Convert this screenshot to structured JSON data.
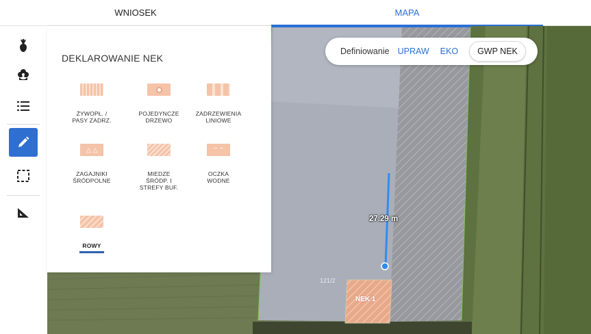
{
  "tabs": {
    "wniosek": "WNIOSEK",
    "mapa": "MAPA"
  },
  "rail": {
    "items": [
      {
        "icon": "crop-icon"
      },
      {
        "icon": "eco-flower-icon"
      },
      {
        "icon": "list-icon"
      },
      {
        "icon": "pencil-icon",
        "active": true
      },
      {
        "icon": "selection-icon"
      },
      {
        "icon": "ruler-icon"
      }
    ]
  },
  "panel": {
    "title": "DEKLAROWANIE NEK",
    "tiles": [
      {
        "label": "ŻYWOPŁ. /\nPASY ZADRZ."
      },
      {
        "label": "POJEDYNCZE\nDRZEWO"
      },
      {
        "label": "ZADRZEWIENIA\nLINIOWE"
      },
      {
        "label": "ZAGAJNIKI\nŚRÓDPOLNE"
      },
      {
        "label": "MIEDZE\nŚRÓDP. I\nSTREFY BUF."
      },
      {
        "label": "OCZKA\nWODNE"
      },
      {
        "label": "ROWY",
        "selected": true
      }
    ]
  },
  "definiowanie": {
    "lead": "Definiowanie",
    "options": [
      "UPRAW",
      "EKO"
    ],
    "selected": "GWP NEK"
  },
  "map": {
    "measurement": "27.29 m",
    "parcel_label": "121/2",
    "feature_label": "NEK 1"
  },
  "colors": {
    "accent": "#2a6fd6",
    "active_rail": "#2f6fcf",
    "nek_fill": "#f2b89a"
  }
}
